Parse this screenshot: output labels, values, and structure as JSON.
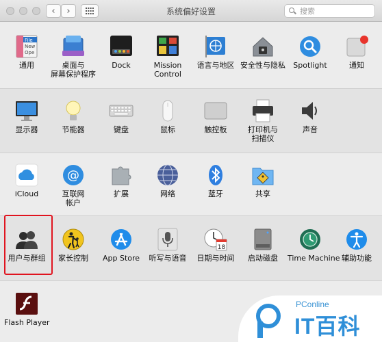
{
  "window": {
    "title": "系统偏好设置",
    "search_placeholder": "搜索",
    "back_glyph": "‹",
    "forward_glyph": "›"
  },
  "rows": [
    [
      {
        "id": "general",
        "label": "通用",
        "icon": "general-icon"
      },
      {
        "id": "desktop",
        "label": "桌面与\n屏幕保护程序",
        "icon": "desktop-icon"
      },
      {
        "id": "dock",
        "label": "Dock",
        "icon": "dock-icon"
      },
      {
        "id": "mission-control",
        "label": "Mission\nControl",
        "icon": "mission-control-icon"
      },
      {
        "id": "language",
        "label": "语言与地区",
        "icon": "globe-flag-icon"
      },
      {
        "id": "security",
        "label": "安全性与隐私",
        "icon": "house-lock-icon"
      },
      {
        "id": "spotlight",
        "label": "Spotlight",
        "icon": "magnifier-icon"
      },
      {
        "id": "notifications",
        "label": "通知",
        "icon": "notifications-icon"
      }
    ],
    [
      {
        "id": "displays",
        "label": "显示器",
        "icon": "display-icon"
      },
      {
        "id": "energy",
        "label": "节能器",
        "icon": "lightbulb-icon"
      },
      {
        "id": "keyboard",
        "label": "键盘",
        "icon": "keyboard-icon"
      },
      {
        "id": "mouse",
        "label": "鼠标",
        "icon": "mouse-icon"
      },
      {
        "id": "trackpad",
        "label": "触控板",
        "icon": "trackpad-icon"
      },
      {
        "id": "printers",
        "label": "打印机与\n扫描仪",
        "icon": "printer-icon"
      },
      {
        "id": "sound",
        "label": "声音",
        "icon": "speaker-icon"
      }
    ],
    [
      {
        "id": "icloud",
        "label": "iCloud",
        "icon": "cloud-icon"
      },
      {
        "id": "internet-accounts",
        "label": "互联网\n帐户",
        "icon": "at-sign-icon"
      },
      {
        "id": "extensions",
        "label": "扩展",
        "icon": "puzzle-icon"
      },
      {
        "id": "network",
        "label": "网络",
        "icon": "network-globe-icon"
      },
      {
        "id": "bluetooth",
        "label": "蓝牙",
        "icon": "bluetooth-icon"
      },
      {
        "id": "sharing",
        "label": "共享",
        "icon": "sharing-folder-icon"
      }
    ],
    [
      {
        "id": "users",
        "label": "用户与群组",
        "icon": "users-icon"
      },
      {
        "id": "parental",
        "label": "家长控制",
        "icon": "parental-controls-icon"
      },
      {
        "id": "app-store",
        "label": "App Store",
        "icon": "app-store-icon"
      },
      {
        "id": "dictation",
        "label": "听写与语音",
        "icon": "microphone-icon"
      },
      {
        "id": "date-time",
        "label": "日期与时间",
        "icon": "clock-calendar-icon"
      },
      {
        "id": "startup-disk",
        "label": "启动磁盘",
        "icon": "hard-disk-icon"
      },
      {
        "id": "time-machine",
        "label": "Time Machine",
        "icon": "time-machine-icon"
      },
      {
        "id": "accessibility",
        "label": "辅助功能",
        "icon": "accessibility-icon"
      }
    ],
    [
      {
        "id": "flash-player",
        "label": "Flash Player",
        "icon": "flash-icon"
      }
    ]
  ],
  "calendar_day": "18",
  "general_icon_text": [
    "File",
    "New",
    "Ope"
  ],
  "watermark": {
    "small": "PConline",
    "big": "IT百科"
  },
  "colors": {
    "highlight": "#e0141f",
    "accent": "#2f8fd8"
  }
}
